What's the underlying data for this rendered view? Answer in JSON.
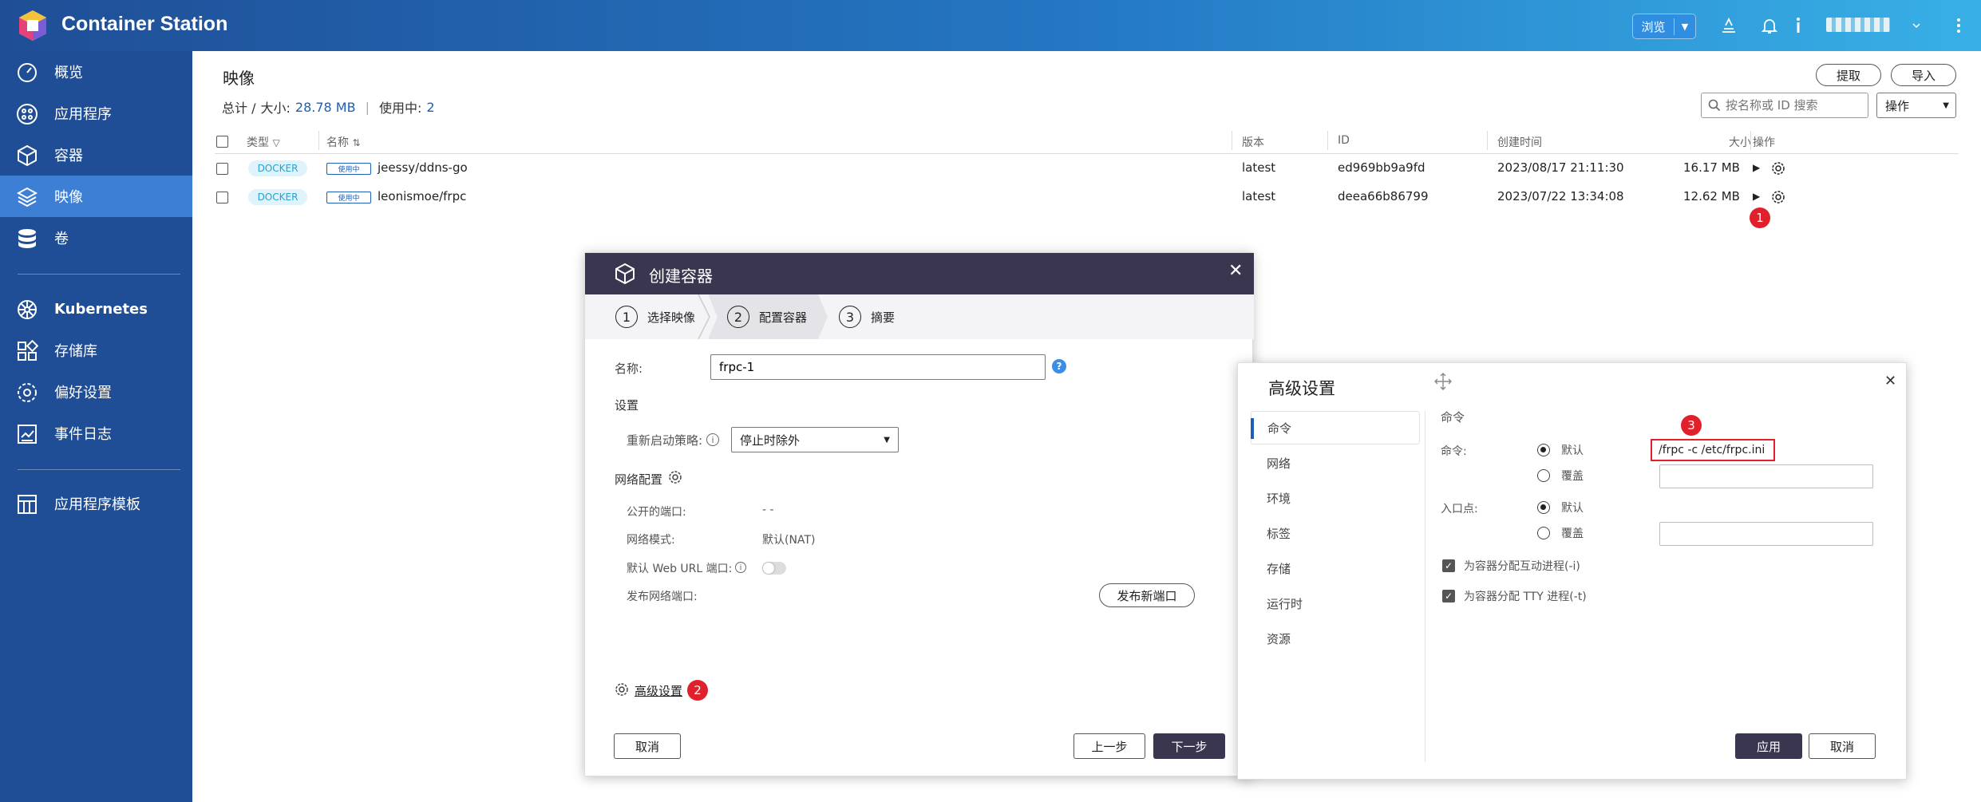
{
  "app": {
    "title": "Container Station"
  },
  "topbar": {
    "browse_label": "浏览"
  },
  "sidebar": {
    "items": [
      {
        "label": "概览",
        "icon": "dashboard-icon"
      },
      {
        "label": "应用程序",
        "icon": "apps-icon"
      },
      {
        "label": "容器",
        "icon": "container-icon"
      },
      {
        "label": "映像",
        "icon": "layers-icon",
        "active": true
      },
      {
        "label": "卷",
        "icon": "database-icon"
      },
      {
        "label": "Kubernetes",
        "icon": "kubernetes-icon"
      },
      {
        "label": "存储库",
        "icon": "registry-icon"
      },
      {
        "label": "偏好设置",
        "icon": "settings-icon"
      },
      {
        "label": "事件日志",
        "icon": "log-icon"
      },
      {
        "label": "应用程序模板",
        "icon": "template-icon"
      }
    ]
  },
  "page": {
    "title": "映像",
    "summary_total_label": "总计 /",
    "summary_size_label": "大小:",
    "summary_size_value": "28.78 MB",
    "summary_inuse_label": "使用中:",
    "summary_inuse_value": "2",
    "pull_label": "提取",
    "import_label": "导入",
    "search_placeholder": "按名称或 ID 搜索",
    "actions_label": "操作"
  },
  "table": {
    "headers": {
      "type": "类型",
      "name": "名称",
      "version": "版本",
      "id": "ID",
      "created": "创建时间",
      "size": "大小",
      "actions": "操作"
    },
    "rows": [
      {
        "type": "DOCKER",
        "status": "使用中",
        "name": "jeessy/ddns-go",
        "version": "latest",
        "id": "ed969bb9a9fd",
        "created": "2023/08/17 21:11:30",
        "size": "16.17 MB"
      },
      {
        "type": "DOCKER",
        "status": "使用中",
        "name": "leonismoe/frpc",
        "version": "latest",
        "id": "deea66b86799",
        "created": "2023/07/22 13:34:08",
        "size": "12.62 MB"
      }
    ]
  },
  "annotations": {
    "badge1": "1",
    "badge2": "2",
    "badge3": "3"
  },
  "create_dialog": {
    "title": "创建容器",
    "steps": [
      {
        "num": "1",
        "label": "选择映像"
      },
      {
        "num": "2",
        "label": "配置容器"
      },
      {
        "num": "3",
        "label": "摘要"
      }
    ],
    "name_label": "名称:",
    "name_value": "frpc-1",
    "settings_label": "设置",
    "restart_label": "重新启动策略:",
    "restart_value": "停止时除外",
    "network_label": "网络配置",
    "public_port_label": "公开的端口:",
    "public_port_value": "- -",
    "net_mode_label": "网络模式:",
    "net_mode_value": "默认(NAT)",
    "web_url_label": "默认 Web URL 端口:",
    "publish_port_label": "发布网络端口:",
    "publish_new_btn": "发布新端口",
    "advanced_label": "高级设置",
    "cancel_btn": "取消",
    "prev_btn": "上一步",
    "next_btn": "下一步"
  },
  "advanced_dialog": {
    "title": "高级设置",
    "nav": [
      "命令",
      "网络",
      "环境",
      "标签",
      "存储",
      "运行时",
      "资源"
    ],
    "section_label": "命令",
    "command_label": "命令:",
    "default_label": "默认",
    "override_label": "覆盖",
    "command_default_value": "/frpc -c /etc/frpc.ini",
    "entrypoint_label": "入口点:",
    "interactive_label": "为容器分配互动进程(-i)",
    "tty_label": "为容器分配 TTY 进程(-t)",
    "apply_btn": "应用",
    "cancel_btn": "取消"
  },
  "colors": {
    "topbar_start": "#1f4e96",
    "topbar_end": "#38b0e6",
    "sidebar": "#1f4e96",
    "sidebar_active": "#3d7fd4",
    "dialog_header": "#3a364f",
    "accent": "#1d5fb5",
    "annotation_red": "#e0202a"
  }
}
